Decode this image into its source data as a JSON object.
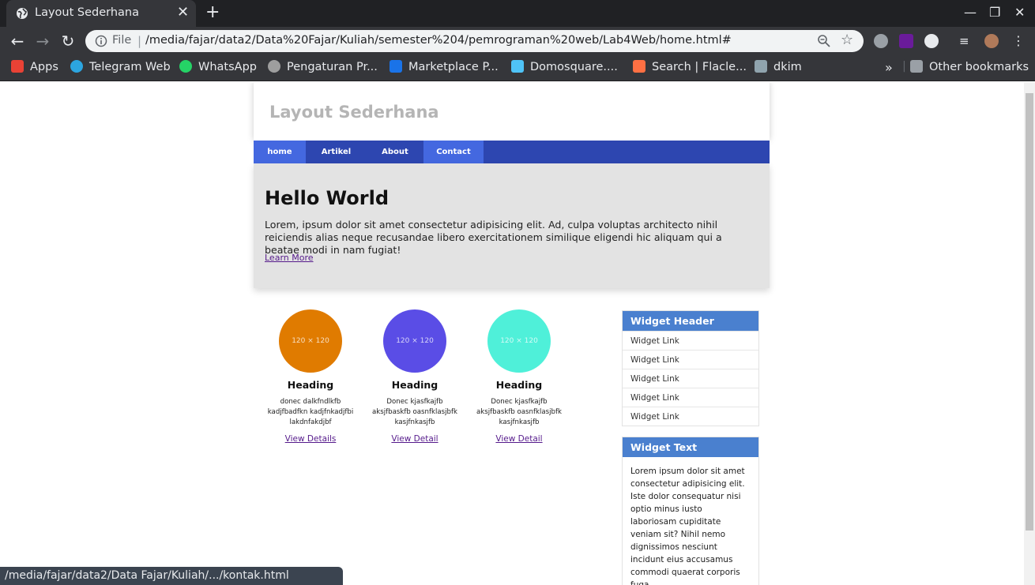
{
  "browser": {
    "tab": {
      "title": "Layout Sederhana",
      "close": "✕"
    },
    "new_tab": "+",
    "window": {
      "minimize": "—",
      "maximize": "❐",
      "close": "✕"
    },
    "omnibox": {
      "scheme_label": "File",
      "separator": "|",
      "url": "/media/fajar/data2/Data%20Fajar/Kuliah/semester%204/pemrograman%20web/Lab4Web/home.html#"
    },
    "bookmarks": [
      {
        "label": "Apps",
        "icon": "apps-grid-icon",
        "color": "#e94235"
      },
      {
        "label": "Telegram Web",
        "icon": "telegram-icon",
        "color": "#2ca5e0"
      },
      {
        "label": "WhatsApp",
        "icon": "whatsapp-icon",
        "color": "#25d366"
      },
      {
        "label": "Pengaturan Pr...",
        "icon": "settings-gear-icon",
        "color": "#9e9e9e"
      },
      {
        "label": "Marketplace P...",
        "icon": "marketplace-icon",
        "color": "#1a73e8"
      },
      {
        "label": "Domosquare....",
        "icon": "domosquare-icon",
        "color": "#4fc3f7"
      },
      {
        "label": "Search | Flacle...",
        "icon": "flacle-icon",
        "color": "#ff7043"
      },
      {
        "label": "dkim",
        "icon": "puzzle-icon",
        "color": "#90a4ae"
      }
    ],
    "bookmarks_overflow": "»",
    "other_bookmarks": "Other bookmarks",
    "status_url": "/media/fajar/data2/Data Fajar/Kuliah/.../kontak.html"
  },
  "page": {
    "site_title": "Layout Sederhana",
    "nav": [
      {
        "label": "home",
        "active": true
      },
      {
        "label": "Artikel",
        "active": false
      },
      {
        "label": "About",
        "active": false
      },
      {
        "label": "Contact",
        "active": true
      }
    ],
    "hero": {
      "heading": "Hello World",
      "text": "Lorem, ipsum dolor sit amet consectetur adipisicing elit. Ad, culpa voluptas architecto nihil reiciendis alias neque recusandae libero exercitationem similique eligendi hic aliquam qui a beatae modi in nam fugiat!",
      "link": "Learn More"
    },
    "cards": [
      {
        "placeholder": "120 × 120",
        "color": "#e07b00",
        "heading": "Heading",
        "text": "donec dalkfndlkfb kadjfbadfkn kadjfnkadjfbi lakdnfakdjbf",
        "link": "View Details"
      },
      {
        "placeholder": "120 × 120",
        "color": "#5a4de6",
        "heading": "Heading",
        "text": "Donec kjasfkajfb aksjfbaskfb oasnfklasjbfk kasjfnkasjfb",
        "link": "View Detail"
      },
      {
        "placeholder": "120 × 120",
        "color": "#4ff0d9",
        "heading": "Heading",
        "text": "Donec kjasfkajfb aksjfbaskfb oasnfklasjbfk kasjfnkasjfb",
        "link": "View Detail"
      }
    ],
    "widget_links": {
      "header": "Widget Header",
      "links": [
        "Widget Link",
        "Widget Link",
        "Widget Link",
        "Widget Link",
        "Widget Link"
      ]
    },
    "widget_text": {
      "header": "Widget Text",
      "text": "Lorem ipsum dolor sit amet consectetur adipisicing elit. Iste dolor consequatur nisi optio minus iusto laboriosam cupiditate veniam sit? Nihil nemo dignissimos nesciunt incidunt eius accusamus commodi quaerat corporis fuga."
    }
  },
  "colors": {
    "nav_bg": "#2d46b0",
    "nav_active": "#4468e0",
    "widget_header": "#4a80cf",
    "hero_bg": "#e3e3e3"
  }
}
